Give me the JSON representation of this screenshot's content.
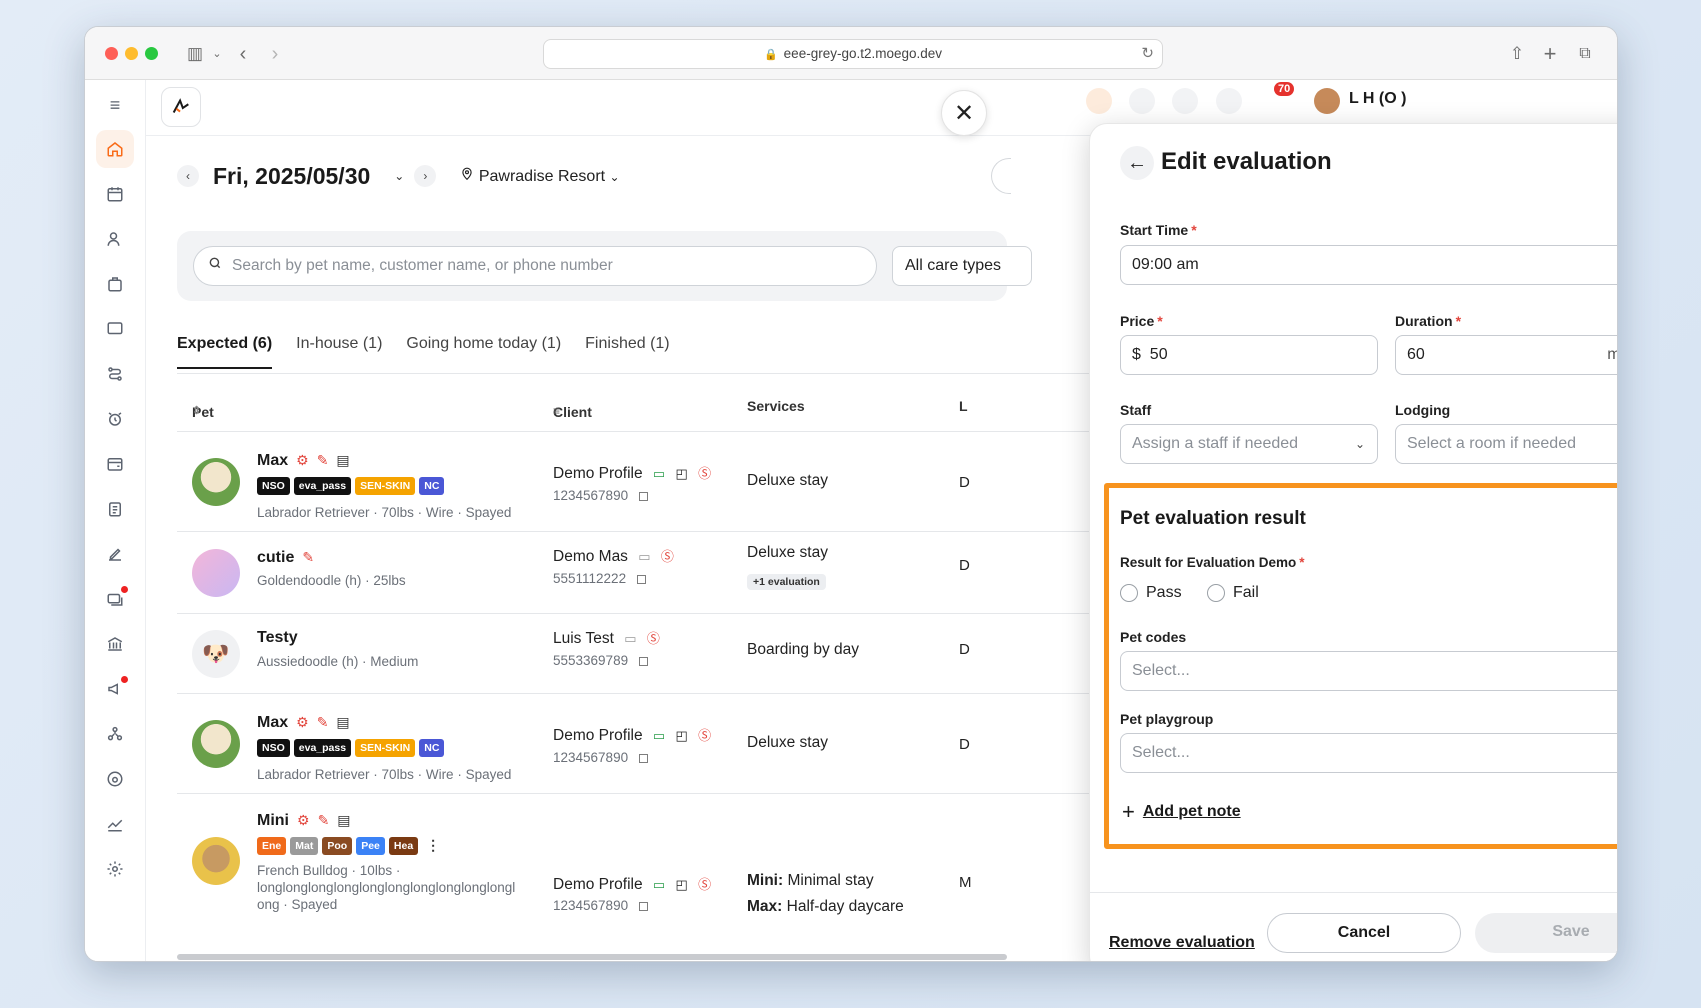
{
  "browser": {
    "url": "eee-grey-go.t2.moego.dev"
  },
  "header": {
    "notification_count": "70",
    "user_name_partial": "L   H        (O     )"
  },
  "date_bar": {
    "date": "Fri, 2025/05/30",
    "location": "Pawradise Resort"
  },
  "search": {
    "placeholder": "Search by pet name, customer name, or phone number",
    "care_types": "All care types"
  },
  "tabs": [
    {
      "label": "Expected (6)"
    },
    {
      "label": "In-house (1)"
    },
    {
      "label": "Going home today (1)"
    },
    {
      "label": "Finished (1)"
    }
  ],
  "table": {
    "headers": {
      "pet": "Pet",
      "client": "Client",
      "services": "Services",
      "lodging_partial": "L"
    },
    "rows": [
      {
        "pet": "Max",
        "tags": [
          {
            "text": "NSO",
            "color": "#111111"
          },
          {
            "text": "eva_pass",
            "color": "#111111"
          },
          {
            "text": "SEN-SKIN",
            "color": "#f5a300"
          },
          {
            "text": "NC",
            "color": "#4a57d6"
          }
        ],
        "breed": "Labrador Retriever · 70lbs · Wire · Spayed",
        "client": "Demo Profile",
        "phone": "1234567890",
        "service": "Deluxe stay",
        "d": "D"
      },
      {
        "pet": "cutie",
        "breed": "Goldendoodle (h) · 25lbs",
        "client": "Demo Mas",
        "phone": "5551112222",
        "service": "Deluxe stay",
        "service_badge": "+1 evaluation",
        "d": "D"
      },
      {
        "pet": "Testy",
        "breed": "Aussiedoodle (h) · Medium",
        "client": "Luis Test",
        "phone": "5553369789",
        "service": "Boarding by day",
        "d": "D"
      },
      {
        "pet": "Max",
        "tags": [
          {
            "text": "NSO",
            "color": "#111111"
          },
          {
            "text": "eva_pass",
            "color": "#111111"
          },
          {
            "text": "SEN-SKIN",
            "color": "#f5a300"
          },
          {
            "text": "NC",
            "color": "#4a57d6"
          }
        ],
        "breed": "Labrador Retriever · 70lbs · Wire · Spayed",
        "client": "Demo Profile",
        "phone": "1234567890",
        "service": "Deluxe stay",
        "d": "D"
      },
      {
        "pet": "Mini",
        "tags": [
          {
            "text": "Ene",
            "color": "#f06a1a"
          },
          {
            "text": "Mat",
            "color": "#9a9a9a"
          },
          {
            "text": "Poo",
            "color": "#8a4b22"
          },
          {
            "text": "Pee",
            "color": "#3b82f6"
          },
          {
            "text": "Hea",
            "color": "#7a3a12"
          }
        ],
        "breed": "French Bulldog · 10lbs · longlonglonglonglonglonglonglonglonglongl ong · Spayed",
        "client": "Demo Profile",
        "phone": "1234567890",
        "service_lines": [
          {
            "who": "Mini:",
            "what": "Minimal stay"
          },
          {
            "who": "Max:",
            "what": "Half-day daycare"
          }
        ],
        "d": "M"
      }
    ]
  },
  "panel": {
    "title": "Edit evaluation",
    "start_time": {
      "label": "Start Time",
      "value": "09:00 am"
    },
    "price": {
      "label": "Price",
      "prefix": "$",
      "value": "50"
    },
    "duration": {
      "label": "Duration",
      "value": "60",
      "suffix": "mins"
    },
    "staff": {
      "label": "Staff",
      "placeholder": "Assign a staff if needed"
    },
    "lodging": {
      "label": "Lodging",
      "placeholder": "Select a room if needed"
    },
    "result_section": {
      "title": "Pet evaluation result",
      "result_label": "Result for Evaluation Demo",
      "options": [
        "Pass",
        "Fail"
      ],
      "pet_codes": {
        "label": "Pet codes",
        "placeholder": "Select..."
      },
      "playgroup": {
        "label": "Pet playgroup",
        "placeholder": "Select..."
      },
      "add_note": "Add pet note"
    },
    "footer": {
      "remove": "Remove evaluation",
      "cancel": "Cancel",
      "save": "Save"
    }
  },
  "colors": {
    "accent": "#f96b18",
    "highlight": "#f7931e",
    "required": "#e2453c"
  }
}
